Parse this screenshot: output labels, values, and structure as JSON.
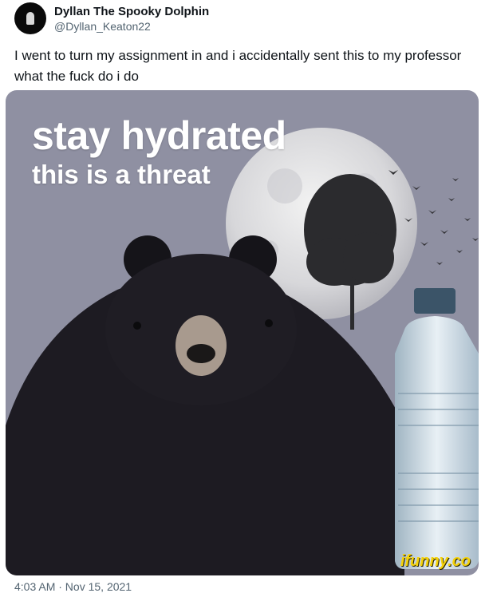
{
  "author": {
    "display_name": "Dyllan The Spooky Dolphin",
    "handle": "@Dyllan_Keaton22"
  },
  "tweet": {
    "text": "I went to turn my assignment in and i accidentally sent this to my professor what the fuck do i do",
    "timestamp": "4:03 AM · Nov 15, 2021"
  },
  "media": {
    "caption_line1": "stay hydrated",
    "caption_line2": "this is a threat",
    "watermark": "ifunny.co"
  },
  "colors": {
    "background": "#ffffff",
    "primary_text": "#0f1419",
    "secondary_text": "#536471",
    "meme_background": "#8f90a2",
    "watermark": "#f5d20a"
  }
}
